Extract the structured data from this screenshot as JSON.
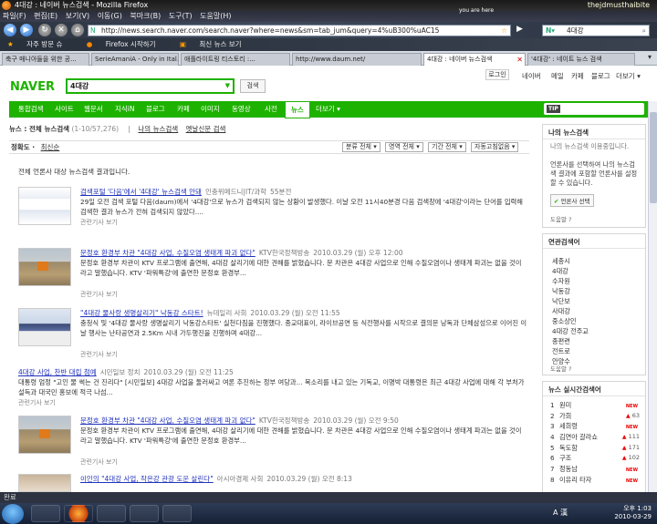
{
  "window": {
    "title": "4대강 : 네이버 뉴스검색 - Mozilla Firefox",
    "user_tag": "thejdmusthaibite",
    "you_are_here": "you are here"
  },
  "menu": [
    "파일(F)",
    "편집(E)",
    "보기(V)",
    "이동(G)",
    "북마크(B)",
    "도구(T)",
    "도움말(H)"
  ],
  "nav": {
    "url": "http://news.search.naver.com/search.naver?where=news&sm=tab_jum&query=4%uB300%uAC15",
    "search_value": "4대강"
  },
  "bookmarks": [
    "자주 방문 슈",
    "Firefox 시작하기",
    "최신 뉴스 보기"
  ],
  "tabs": [
    {
      "label": "축구 매니아들을 위한 공..."
    },
    {
      "label": "SerieAmaniA - Only in Ital..."
    },
    {
      "label": "애플라이트링 티스토리 :..."
    },
    {
      "label": "http://www.daum.net/"
    },
    {
      "label": "4대강 : 네이버 뉴스검색"
    },
    {
      "label": "'4대강' : 네이트 뉴스 검색"
    }
  ],
  "naver": {
    "logo": "NAVER",
    "query": "4대강",
    "search_btn": "검색",
    "login": "로그인",
    "toplinks": [
      "네이버",
      "메일",
      "카페",
      "블로그",
      "더보기 ▾"
    ],
    "gnav": [
      "통합검색",
      "사이트",
      "웹문서",
      "지식iN",
      "블로그",
      "카페",
      "이미지",
      "동영상",
      "사전",
      "뉴스",
      "더보기 ▾"
    ],
    "gnav_active": "뉴스",
    "tip_badge": "TIP",
    "tip": "한번가정을로 지정된 동률은?",
    "subnav": {
      "label": "뉴스 : ",
      "all": "전체 뉴스검색",
      "count": "(1-10/57,276)",
      "my": "나의 뉴스검색",
      "old": "옛날신문 검색"
    },
    "sort": {
      "label": "정확도 ·",
      "latest": "최신순",
      "filters": [
        "분류 전체 ▾",
        "영역 전체 ▾",
        "기간 전체 ▾",
        "자동고침없음 ▾"
      ]
    },
    "notice": "전체 언론사 대상 뉴스검색 결과입니다."
  },
  "results": [
    {
      "title": "검색포털 '다음'에서 '4대강' 뉴스검색 안돼",
      "source": "인충위메드니|IT/과학",
      "time": "55분전",
      "desc": "29일 오전 검색 포털 다음(daum)에서 '4대강'으로 뉴스가 검색되지 않는 상황이 발생했다. 이날 오전 11시40분경 다음 검색창에 '4대강'이라는 단어를 입력해 검색한 결과 뉴스가 전혀 검색되지 않았다....",
      "rel": "관련기사 보기"
    },
    {
      "title": "문정호 환경부 차관 \"4대강 사업, 수질오염 생태계 파괴 없다\"",
      "source": "KTV한국정책방송",
      "time": "2010.03.29 (월) 오후 12:00",
      "desc": "문정호 환경부 차관이 KTV 프로그램에 출연해, 4대강 살리기에 대한 견해를 밝혔습니다. 문 차관은 4대강 사업으로 인해 수질오염이나 생태계 파괴는 없을 것이라고 말했습니다. KTV '파워특강'에 출연한 문정호 환경부...",
      "rel": "관련기사 보기"
    },
    {
      "title": "\"4대강 물사랑 생명살리기\" 낙동강 스타트!",
      "source": "뉴데일리 사회",
      "time": "2010.03.29 (월) 오전 11:55",
      "desc": "충청식 및 '4대강 물사랑 생명살리기 낙동강스타트' 실천다짐을 진행했다. 종교대표이, 라이브공연 등 식전행사를 시작으로 결의문 낭독과 단체삼성으로 이어진 이날 행사는 난타공연과 2.5Km 시내 가두행진을 진행하며 4대강...",
      "rel": "관련기사 보기"
    },
    {
      "title": "4대강 사업, 찬반 대립 첨예",
      "source": "시민일보 정치",
      "time": "2010.03.29 (월) 오전 11:25",
      "desc": "대통령 엄정 \"고인 물 썩는 건 진리다\" [시민일보] 4대강 사업을 둘러싸고 여론 추진하는 정부 여당과... 목소리를 내고 있는 기독교, 이명박 대통령은 최근 4대강 사업에 대해 각 부처가 설득과 대국민 홍보에 적극 나섬...",
      "rel": "관련기사 보기"
    },
    {
      "title": "문정호 환경부 차관 \"4대강 사업, 수질오염 생태계 파괴 없다\"",
      "source": "KTV한국정책방송",
      "time": "2010.03.29 (월) 오전 9:50",
      "desc": "문정호 환경부 차관이 KTV 프로그램에 출연해, 4대강 살리기에 대한 견해를 밝혔습니다. 문 차관은 4대강 사업으로 인해 수질오염이나 생태계 파괴는 없을 것이라고 말했습니다. KTV '파워특강'에 출연한 문정호 환경부...",
      "rel": "관련기사 보기"
    },
    {
      "title": "이인의 \"4대강 사업, 작은강 관광 도운 살린다\"",
      "source": "아시아경제 사회",
      "time": "2010.03.29 (월) 오전 8:13",
      "desc": "",
      "rel": ""
    }
  ],
  "sidebar": {
    "my_news": {
      "title": "나의 뉴스검색",
      "subtitle": "나의 뉴스검색 이용중입니다.",
      "desc": "언론사를 선택하여 나의 뉴스검색 결과에 포함할 언론사를 설정할 수 있습니다.",
      "btn": "언론사 선택",
      "help": "도움말 ?"
    },
    "related": {
      "title": "연관검색어",
      "items": [
        "세종시",
        "4대강",
        "수자원",
        "낙동강",
        "낙단보",
        "사대강",
        "중소상인",
        "4대강 전주교",
        "종편련",
        "전트로",
        "안양수"
      ],
      "help": "도움말 ?"
    },
    "realtime": {
      "title": "뉴스 실시간검색어",
      "items": [
        {
          "rank": "1",
          "kw": "원미",
          "trend": "NEW",
          "change": ""
        },
        {
          "rank": "2",
          "kw": "가희",
          "trend": "up",
          "change": "63"
        },
        {
          "rank": "3",
          "kw": "세희령",
          "trend": "NEW",
          "change": ""
        },
        {
          "rank": "4",
          "kw": "김연아 갈라쇼",
          "trend": "up",
          "change": "111"
        },
        {
          "rank": "5",
          "kw": "독도함",
          "trend": "up",
          "change": "171"
        },
        {
          "rank": "6",
          "kw": "구조",
          "trend": "up",
          "change": "102"
        },
        {
          "rank": "7",
          "kw": "정동남",
          "trend": "NEW",
          "change": ""
        },
        {
          "rank": "8",
          "kw": "이유리 타자",
          "trend": "NEW",
          "change": ""
        }
      ]
    }
  },
  "status": {
    "text": "완료",
    "time": "오후 1:03",
    "date": "2010-03-29",
    "ime": "A 漢"
  },
  "colors": {
    "naver_green": "#1eb200",
    "link_blue": "#2233bb",
    "new_red": "#ee0000"
  }
}
